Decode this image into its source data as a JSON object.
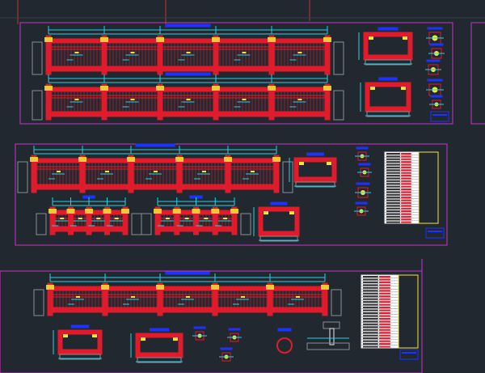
{
  "colors": {
    "background": "#212830",
    "sheet_border": "#c833c8",
    "grid_line": "#c83232",
    "beam_red": "#e01c2c",
    "dim_cyan": "#25d2e6",
    "label_blue": "#1e32ff",
    "note_yellow": "#f5e63c",
    "white": "#e8e8e8",
    "gray": "#8a8f96"
  },
  "icons": {
    "sheet": "drawing-sheet",
    "detail": "section-detail",
    "table": "rebar-schedule-table"
  }
}
